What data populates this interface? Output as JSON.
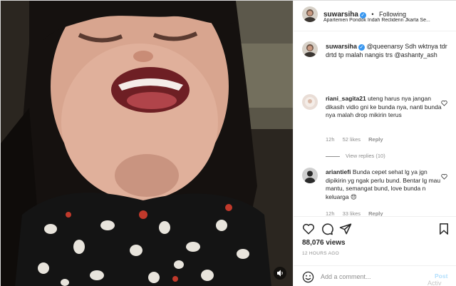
{
  "header": {
    "username": "suwarsiha",
    "separator": "•",
    "follow_status": "Following",
    "location": "Apartemen Pondok Indah Reclidenn Jkarta Se..."
  },
  "caption": {
    "username": "suwarsiha",
    "text": "@queenarsy Sdh wktnya tdr drtd tp malah nangis trs @ashanty_ash"
  },
  "comments": [
    {
      "username": "riani_sagita21",
      "text": "uteng harus nya jangan dikasih vidio gni ke bunda nya, nanti bunda nya malah drop mikirin terus",
      "time": "12h",
      "likes": "52 likes",
      "reply": "Reply",
      "view_replies": "View replies (10)"
    },
    {
      "username": "ariantiefi",
      "text": "Bunda cepet sehat lg ya jgn dipikirin yg ngak perlu bund. Bentar lg mau mantu, semangat bund, love bunda n keluarga 😍",
      "time": "12h",
      "likes": "33 likes",
      "reply": "Reply"
    }
  ],
  "stats": {
    "views": "88,076 views",
    "time_ago": "12 HOURS AGO"
  },
  "add_comment": {
    "placeholder": "Add a comment...",
    "post_label": "Post"
  },
  "watermark": "Activ",
  "icons": {
    "like": "heart-icon",
    "comment": "comment-icon",
    "share": "share-icon",
    "save": "bookmark-icon",
    "more": "more-icon",
    "verified": "verified-icon",
    "volume": "speaker-icon",
    "emoji": "emoji-icon"
  },
  "colors": {
    "verified_blue": "#3897f0",
    "post_disabled": "#b2dffc",
    "muted": "#8e8e8e"
  }
}
